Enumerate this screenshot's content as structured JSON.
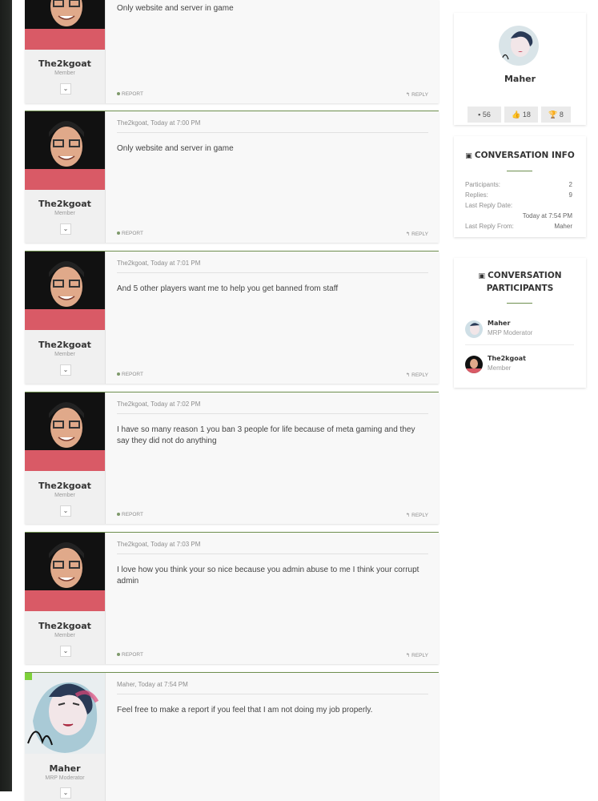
{
  "messages": [
    {
      "author": "The2kgoat",
      "role": "Member",
      "meta": "",
      "text": "Only website and server in game",
      "report": "REPORT",
      "reply": "REPLY"
    },
    {
      "author": "The2kgoat",
      "role": "Member",
      "meta": "The2kgoat, Today at 7:00 PM",
      "text": "Only website and server in game",
      "report": "REPORT",
      "reply": "REPLY"
    },
    {
      "author": "The2kgoat",
      "role": "Member",
      "meta": "The2kgoat, Today at 7:01 PM",
      "text": "And 5 other players want me to help you get banned from staff",
      "report": "REPORT",
      "reply": "REPLY"
    },
    {
      "author": "The2kgoat",
      "role": "Member",
      "meta": "The2kgoat, Today at 7:02 PM",
      "text": "I have so many reason 1 you ban 3 people for life because of meta gaming and they say they did not do anything",
      "report": "REPORT",
      "reply": "REPLY"
    },
    {
      "author": "The2kgoat",
      "role": "Member",
      "meta": "The2kgoat, Today at 7:03 PM",
      "text": "I love how you think your so nice because you admin abuse to me I think your corrupt admin",
      "report": "REPORT",
      "reply": "REPLY"
    },
    {
      "author": "Maher",
      "role": "MRP Moderator",
      "meta": "Maher, Today at 7:54 PM",
      "text": "Feel free to make a report if you feel that I am not doing my job properly."
    }
  ],
  "profile": {
    "name": "Maher",
    "stats": [
      {
        "icon": "message-icon",
        "value": "56"
      },
      {
        "icon": "thumbs-up-icon",
        "value": "18"
      },
      {
        "icon": "trophy-icon",
        "value": "8"
      }
    ]
  },
  "conversation_info": {
    "title": "CONVERSATION INFO",
    "rows": [
      {
        "label": "Participants:",
        "value": "2"
      },
      {
        "label": "Replies:",
        "value": "9"
      },
      {
        "label": "Last Reply Date:",
        "value": "Today at 7:54 PM"
      },
      {
        "label": "Last Reply From:",
        "value": "Maher"
      }
    ]
  },
  "participants_widget": {
    "title_line1": "CONVERSATION",
    "title_line2": "PARTICIPANTS",
    "people": [
      {
        "name": "Maher",
        "role": "MRP Moderator"
      },
      {
        "name": "The2kgoat",
        "role": "Member"
      }
    ]
  },
  "colors": {
    "accent": "#6e8f4f",
    "panel": "#f8f8f8",
    "side": "#f0f0f0"
  },
  "toggle_icon": "chevron-down-icon"
}
